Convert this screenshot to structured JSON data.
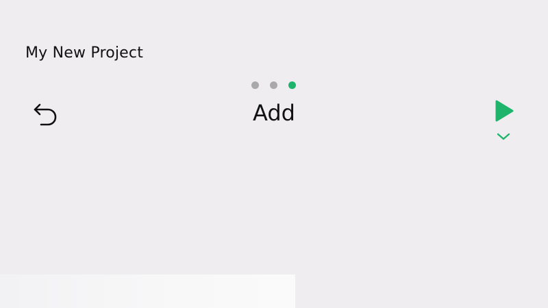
{
  "project": {
    "title": "My New Project"
  },
  "header": {
    "title": "Add",
    "page_indicator": {
      "total": 3,
      "active_index": 2
    }
  },
  "icons": {
    "undo": "undo-arrow-icon",
    "play": "play-icon",
    "chevron": "chevron-down-icon"
  },
  "colors": {
    "background": "#efedf0",
    "accent": "#1eb46b",
    "dot_inactive": "#a9a8ab",
    "text": "#111111"
  }
}
